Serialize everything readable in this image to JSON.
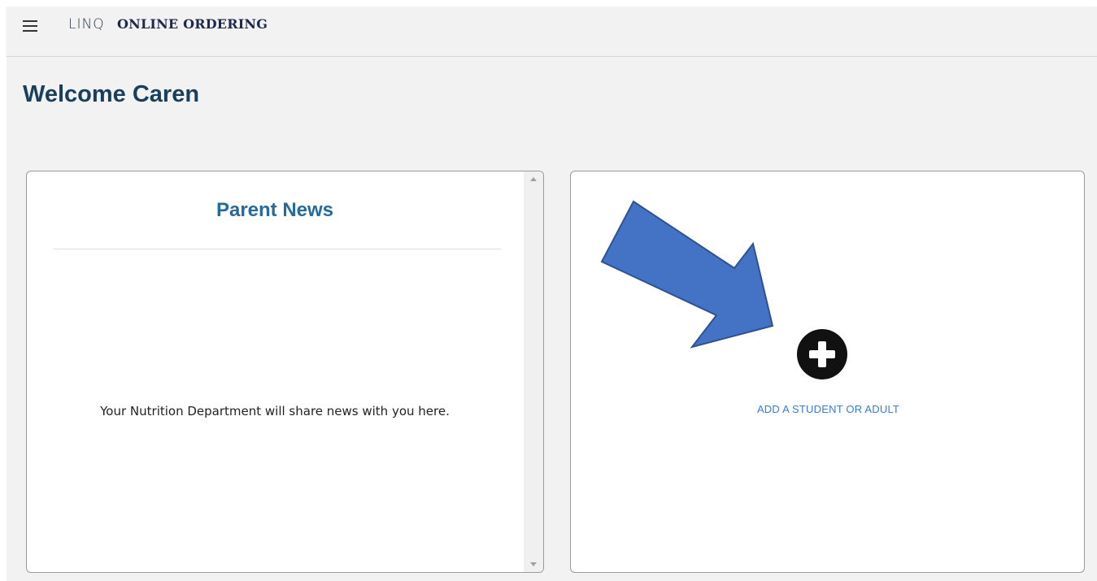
{
  "header": {
    "brand_prefix": "LINQ",
    "brand_title": "ONLINE ORDERING",
    "menu_icon": "hamburger-menu-icon"
  },
  "welcome": {
    "text": "Welcome Caren"
  },
  "news_card": {
    "title": "Parent News",
    "body": "Your Nutrition Department will share news with you here."
  },
  "add_card": {
    "icon": "plus-circle-icon",
    "label": "ADD A STUDENT OR ADULT"
  },
  "annotation": {
    "arrow_icon": "pointer-arrow-icon",
    "color": "#4472c4"
  },
  "colors": {
    "header_bg": "#f2f2f2",
    "title_blue": "#246a9a",
    "welcome_text": "#1a3f5a",
    "link_blue": "#3a7bd5"
  }
}
